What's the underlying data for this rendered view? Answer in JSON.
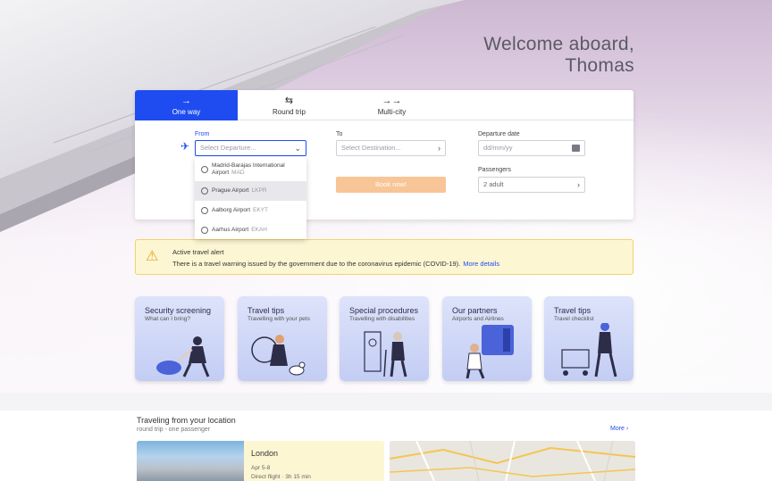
{
  "welcome": {
    "line1": "Welcome aboard,",
    "line2": "Thomas"
  },
  "tabs": [
    {
      "icon": "→",
      "label": "One way",
      "active": true
    },
    {
      "icon": "⇆",
      "label": "Round trip",
      "active": false
    },
    {
      "icon": "→→",
      "label": "Multi-city",
      "active": false
    }
  ],
  "search": {
    "from_label": "From",
    "from_placeholder": "Select Departure...",
    "to_label": "To",
    "to_placeholder": "Select Destination...",
    "date_label": "Departure date",
    "date_placeholder": "dd/mm/yy",
    "passengers_label": "Passengers",
    "passengers_value": "2 adult",
    "book_label": "Book now!"
  },
  "dropdown": [
    {
      "name": "Madrid-Barajas International",
      "name2": "Airport",
      "code": "MAD"
    },
    {
      "name": "Prague Airport",
      "code": "LKPR"
    },
    {
      "name": "Aalborg Airport",
      "code": "EKYT"
    },
    {
      "name": "Aarhus Airport",
      "code": "EKAH"
    }
  ],
  "alert": {
    "title": "Active travel alert",
    "text": "There is a travel warning issued by the government due to the coronavirus epidemic (COVID-19).",
    "link": "More details"
  },
  "tiles": [
    {
      "title": "Security screening",
      "subtitle": "What can I bring?"
    },
    {
      "title": "Travel tips",
      "subtitle": "Travelling with your pets"
    },
    {
      "title": "Special procedures",
      "subtitle": "Travelling with disabilities"
    },
    {
      "title": "Our partners",
      "subtitle": "Airports and Airlines"
    },
    {
      "title": "Travel tips",
      "subtitle": "Travel checklist"
    }
  ],
  "location": {
    "title": "Traveling from your location",
    "subtitle": "round trip - one passenger",
    "more": "More ›",
    "destination": "London",
    "dates": "Apr 5-8",
    "flight": "Direct flight  ·  3h 15 min"
  },
  "colors": {
    "accent": "#1f4cf0",
    "book": "#f8c596",
    "alert_bg": "#fdf6d3",
    "tile": "#c3cdf4"
  }
}
